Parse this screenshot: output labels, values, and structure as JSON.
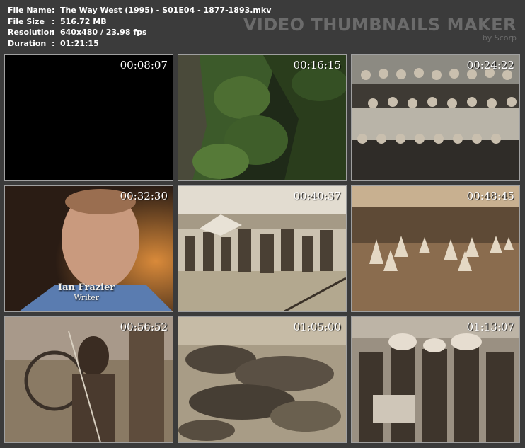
{
  "info": {
    "rows": [
      {
        "key": "File Name",
        "sep": ":",
        "value": "The Way West (1995) - S01E04 - 1877-1893.mkv"
      },
      {
        "key": "File Size",
        "sep": ":",
        "value": "516.72 MB"
      },
      {
        "key": "Resolution",
        "sep": ":",
        "value": "640x480 / 23.98 fps"
      },
      {
        "key": "Duration",
        "sep": ":",
        "value": "01:21:15"
      }
    ]
  },
  "brand": {
    "title": "VIDEO THUMBNAILS MAKER",
    "subtitle": "by Scorp"
  },
  "thumbnails": [
    {
      "time": "00:08:07"
    },
    {
      "time": "00:16:15"
    },
    {
      "time": "00:24:22"
    },
    {
      "time": "00:32:30",
      "caption_name": "Ian Frazier",
      "caption_role": "Writer"
    },
    {
      "time": "00:40:37"
    },
    {
      "time": "00:48:45"
    },
    {
      "time": "00:56:52"
    },
    {
      "time": "01:05:00"
    },
    {
      "time": "01:13:07"
    }
  ]
}
